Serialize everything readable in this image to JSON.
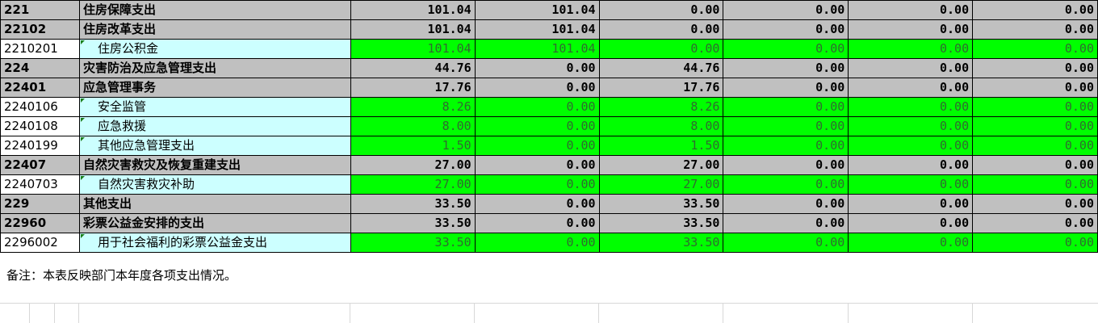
{
  "rows": [
    {
      "type": "grp",
      "code": "221",
      "name": "住房保障支出",
      "v": [
        "101.04",
        "101.04",
        "0.00",
        "0.00",
        "0.00",
        "0.00"
      ]
    },
    {
      "type": "grp",
      "code": "22102",
      "name": "住房改革支出",
      "v": [
        "101.04",
        "101.04",
        "0.00",
        "0.00",
        "0.00",
        "0.00"
      ]
    },
    {
      "type": "leaf",
      "code": "2210201",
      "name": "住房公积金",
      "v": [
        "101.04",
        "101.04",
        "0.00",
        "0.00",
        "0.00",
        "0.00"
      ]
    },
    {
      "type": "grp",
      "code": "224",
      "name": "灾害防治及应急管理支出",
      "v": [
        "44.76",
        "0.00",
        "44.76",
        "0.00",
        "0.00",
        "0.00"
      ]
    },
    {
      "type": "grp",
      "code": "22401",
      "name": "应急管理事务",
      "v": [
        "17.76",
        "0.00",
        "17.76",
        "0.00",
        "0.00",
        "0.00"
      ]
    },
    {
      "type": "leaf",
      "code": "2240106",
      "name": "安全监管",
      "v": [
        "8.26",
        "0.00",
        "8.26",
        "0.00",
        "0.00",
        "0.00"
      ]
    },
    {
      "type": "leaf",
      "code": "2240108",
      "name": "应急救援",
      "v": [
        "8.00",
        "0.00",
        "8.00",
        "0.00",
        "0.00",
        "0.00"
      ]
    },
    {
      "type": "leaf",
      "code": "2240199",
      "name": "其他应急管理支出",
      "v": [
        "1.50",
        "0.00",
        "1.50",
        "0.00",
        "0.00",
        "0.00"
      ]
    },
    {
      "type": "grp",
      "code": "22407",
      "name": "自然灾害救灾及恢复重建支出",
      "v": [
        "27.00",
        "0.00",
        "27.00",
        "0.00",
        "0.00",
        "0.00"
      ]
    },
    {
      "type": "leaf",
      "code": "2240703",
      "name": "自然灾害救灾补助",
      "v": [
        "27.00",
        "0.00",
        "27.00",
        "0.00",
        "0.00",
        "0.00"
      ]
    },
    {
      "type": "grp",
      "code": "229",
      "name": "其他支出",
      "v": [
        "33.50",
        "0.00",
        "33.50",
        "0.00",
        "0.00",
        "0.00"
      ]
    },
    {
      "type": "grp",
      "code": "22960",
      "name": "彩票公益金安排的支出",
      "v": [
        "33.50",
        "0.00",
        "33.50",
        "0.00",
        "0.00",
        "0.00"
      ]
    },
    {
      "type": "leaf",
      "code": "2296002",
      "name": "用于社会福利的彩票公益金支出",
      "v": [
        "33.50",
        "0.00",
        "33.50",
        "0.00",
        "0.00",
        "0.00"
      ]
    }
  ],
  "note": "备注：本表反映部门本年度各项支出情况。"
}
